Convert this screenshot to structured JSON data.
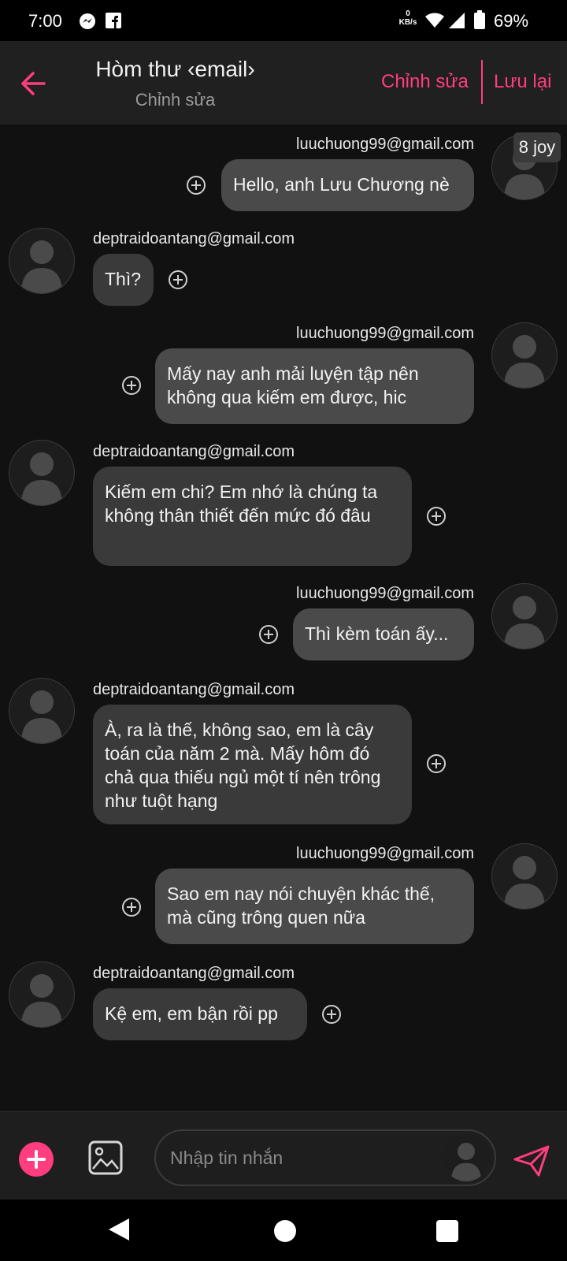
{
  "status_bar": {
    "time": "7:00",
    "net_speed_value": "0",
    "net_speed_unit": "KB/s",
    "battery": "69%",
    "icons": [
      "messenger-icon",
      "facebook-icon",
      "wifi-icon",
      "signal-icon",
      "battery-icon"
    ]
  },
  "header": {
    "title": "Hòm thư ‹email›",
    "subtitle": "Chỉnh sửa",
    "edit_label": "Chỉnh sửa",
    "save_label": "Lưu lại"
  },
  "badge": {
    "text": "8 joy"
  },
  "messages": [
    {
      "side": "right",
      "sender": "luuchuong99@gmail.com",
      "text": "Hello, anh Lưu Chương nè"
    },
    {
      "side": "left",
      "sender": "deptraidoantang@gmail.com",
      "text": "Thì?"
    },
    {
      "side": "right",
      "sender": "luuchuong99@gmail.com",
      "text": "Mấy nay anh mải luyện tập nên không qua kiếm em được, hic"
    },
    {
      "side": "left",
      "sender": "deptraidoantang@gmail.com",
      "text": "Kiếm em chi? Em nhớ là chúng ta không thân thiết đến mức đó đâu"
    },
    {
      "side": "right",
      "sender": "luuchuong99@gmail.com",
      "text": "Thì kèm toán ấy..."
    },
    {
      "side": "left",
      "sender": "deptraidoantang@gmail.com",
      "text": "À, ra là thế, không sao, em là cây toán của năm 2 mà. Mấy hôm đó chả qua thiếu ngủ một tí nên trông như tuột hạng"
    },
    {
      "side": "right",
      "sender": "luuchuong99@gmail.com",
      "text": "Sao em nay nói chuyện khác thế, mà cũng trông quen nữa"
    },
    {
      "side": "left",
      "sender": "deptraidoantang@gmail.com",
      "text": "Kệ em, em bận rồi pp"
    }
  ],
  "composer": {
    "placeholder": "Nhập tin nhắn"
  },
  "colors": {
    "accent": "#ff3d7f",
    "background": "#111111",
    "bubble": "#3a3a3a"
  }
}
